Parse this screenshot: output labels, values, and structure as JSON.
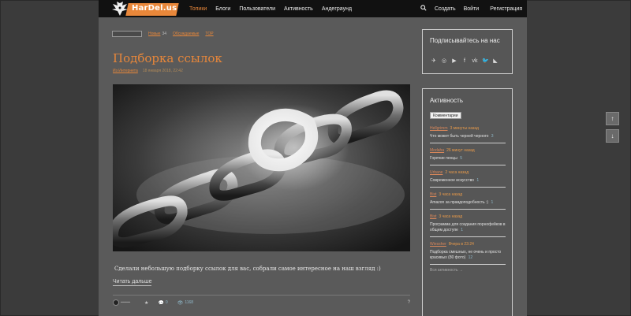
{
  "header": {
    "logo_text": "HarDel.us",
    "nav": [
      {
        "label": "Топики",
        "active": true
      },
      {
        "label": "Блоги"
      },
      {
        "label": "Пользователи"
      },
      {
        "label": "Активность"
      },
      {
        "label": "Андеграунд"
      }
    ],
    "search_icon": "search-icon",
    "create_label": "Создать",
    "login_label": "Войти",
    "register_label": "Регистрация"
  },
  "breadcrumbs": {
    "new_label": "Новые",
    "new_count": "34",
    "discussed_label": "Обсуждаемые",
    "top_label": "TOP"
  },
  "post": {
    "title": "Подборка ссылок",
    "author": "Из Интернета",
    "date": "18 января 2018, 22:42",
    "text": "Сделали небольшую подборку ссылок для вас, собрали самое интересное на наш взгляд :)",
    "read_more": "Читать дальше",
    "footer": {
      "comments": "0",
      "views": "1168",
      "share": "?"
    }
  },
  "sidebar": {
    "subscribe_title": "Подписывайтесь на нас",
    "social_icons": [
      "telegram-icon",
      "instagram-icon",
      "youtube-icon",
      "facebook-icon",
      "vk-icon",
      "twitter-icon",
      "rss-icon"
    ],
    "activity_title": "Активность",
    "activity_tab": "Комментарии",
    "activity": [
      {
        "user": "Hellgrimm",
        "time": "3 минуты назад",
        "text": "Что может быть черней черного",
        "comments": "3"
      },
      {
        "user": "Modaha",
        "time": "26 минут назад",
        "text": "Горячие пенцы",
        "comments": "5"
      },
      {
        "user": "Urbane",
        "time": "2 часа назад",
        "text": "Современное искусство",
        "comments": "1"
      },
      {
        "user": "Bist",
        "time": "3 часа назад",
        "text": "Amazon за правдоподобность :)",
        "comments": "1"
      },
      {
        "user": "Bist",
        "time": "3 часа назад",
        "text": "Программа для создания порнофейков в общем доступе",
        "comments": "1"
      },
      {
        "user": "Wiessher",
        "time": "Вчера в 23:24",
        "text": "Подборка смешных, не очень и просто красивых (80 фото)",
        "comments": "12"
      }
    ],
    "activity_more": "Вся активность →"
  },
  "scroll": {
    "up": "↑",
    "down": "↓"
  }
}
